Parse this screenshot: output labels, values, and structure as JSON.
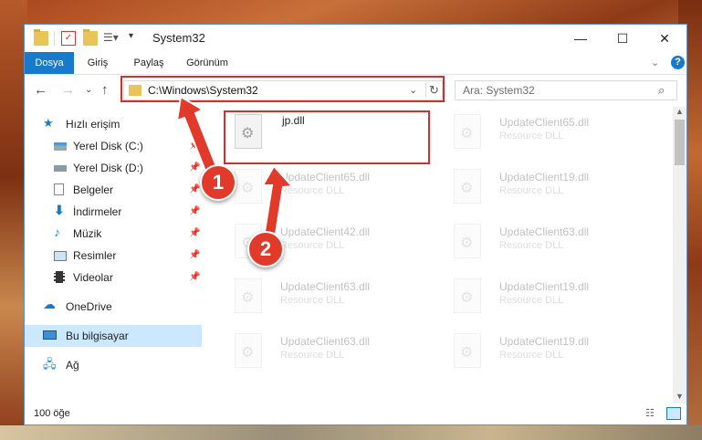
{
  "window": {
    "title": "System32"
  },
  "ribbon": {
    "tabs": [
      "Dosya",
      "Giriş",
      "Paylaş",
      "Görünüm"
    ]
  },
  "address": {
    "path": "C:\\Windows\\System32"
  },
  "search": {
    "placeholder": "Ara: System32"
  },
  "sidebar": {
    "quick_access": "Hızlı erişim",
    "items": [
      "Yerel Disk (C:)",
      "Yerel Disk (D:)",
      "Belgeler",
      "İndirmeler",
      "Müzik",
      "Resimler",
      "Videolar"
    ],
    "onedrive": "OneDrive",
    "this_pc": "Bu bilgisayar",
    "network": "Ağ"
  },
  "files": [
    {
      "name": "jp.dll",
      "desc": ""
    },
    {
      "name": "UpdateClient65.dll",
      "desc": "Resource DLL"
    },
    {
      "name": "UpdateClient65.dll",
      "desc": "Resource DLL"
    },
    {
      "name": "UpdateClient19.dll",
      "desc": "Resource DLL"
    },
    {
      "name": "UpdateClient42.dll",
      "desc": "Resource DLL"
    },
    {
      "name": "UpdateClient63.dll",
      "desc": "Resource DLL"
    },
    {
      "name": "UpdateClient63.dll",
      "desc": "Resource DLL"
    },
    {
      "name": "UpdateClient19.dll",
      "desc": "Resource DLL"
    },
    {
      "name": "UpdateClient63.dll",
      "desc": "Resource DLL"
    },
    {
      "name": "UpdateClient19.dll",
      "desc": "Resource DLL"
    }
  ],
  "status": {
    "count": "100 öğe"
  },
  "annotations": {
    "badge1": "1",
    "badge2": "2"
  },
  "colors": {
    "accent": "#1979ca",
    "highlight": "#d62e2e"
  }
}
